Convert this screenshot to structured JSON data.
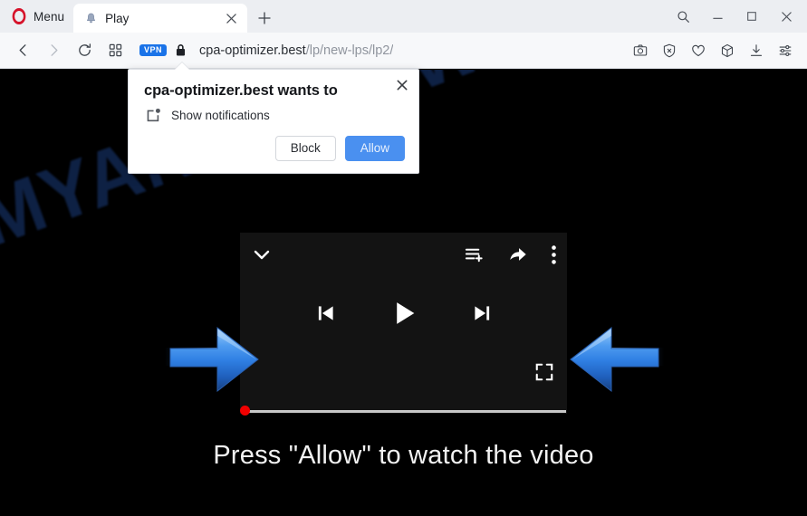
{
  "browser": {
    "name": "Opera",
    "menu_label": "Menu",
    "tab": {
      "title": "Play",
      "favicon": "bell-favicon",
      "close_label": "×"
    },
    "new_tab_label": "+",
    "window_controls": [
      {
        "name": "search-icon",
        "label": "Search"
      },
      {
        "name": "minimize-icon",
        "label": "Minimize"
      },
      {
        "name": "maximize-icon",
        "label": "Maximize"
      },
      {
        "name": "close-icon",
        "label": "Close"
      }
    ],
    "navigation": [
      {
        "name": "back-button",
        "label": "Back",
        "enabled": true
      },
      {
        "name": "forward-button",
        "label": "Forward",
        "enabled": false
      },
      {
        "name": "reload-button",
        "label": "Reload",
        "enabled": true
      },
      {
        "name": "tab-overview-button",
        "label": "Tab overview",
        "enabled": true
      }
    ],
    "address_bar": {
      "vpn_badge": "VPN",
      "lock_icon": "lock-icon",
      "url_domain": "cpa-optimizer.best",
      "url_path": "/lp/new-lps/lp2/",
      "full_url": "cpa-optimizer.best/lp/new-lps/lp2/"
    },
    "toolbar_icons": [
      {
        "name": "snapshot-icon",
        "label": "Snapshot"
      },
      {
        "name": "ad-blocker-icon",
        "label": "Ad blocker"
      },
      {
        "name": "heart-icon",
        "label": "Add to favorites"
      },
      {
        "name": "cube-icon",
        "label": "Extensions"
      },
      {
        "name": "downloads-icon",
        "label": "Downloads"
      },
      {
        "name": "easy-setup-icon",
        "label": "Easy setup"
      }
    ]
  },
  "permission_dialog": {
    "title": "cpa-optimizer.best wants to",
    "permission_icon": "notification-icon",
    "permission_text": "Show notifications",
    "block_label": "Block",
    "allow_label": "Allow",
    "close_label": "×",
    "allow_color": "#4a90f0"
  },
  "page": {
    "watermark": "MYANTISPYWARE.COM",
    "watermark_color": "#10244a",
    "cta_text": "Press \"Allow\" to watch the video",
    "background_color": "#000000",
    "player": {
      "background_color": "#131313",
      "top_controls": [
        {
          "name": "collapse-chevron-icon",
          "label": "Collapse"
        },
        {
          "name": "add-to-queue-icon",
          "label": "Add to queue"
        },
        {
          "name": "share-icon",
          "label": "Share"
        },
        {
          "name": "more-options-icon",
          "label": "More options"
        }
      ],
      "transport_controls": [
        {
          "name": "previous-track-button",
          "label": "Previous"
        },
        {
          "name": "play-button",
          "label": "Play"
        },
        {
          "name": "next-track-button",
          "label": "Next"
        }
      ],
      "fullscreen_label": "Fullscreen",
      "progress_dot_color": "#f10000",
      "progress_track_color": "#c8c8c8",
      "progress_percent": 0
    },
    "arrows": [
      {
        "name": "pointing-arrow-right",
        "direction": "right",
        "color": "#2f86ec"
      },
      {
        "name": "pointing-arrow-left",
        "direction": "left",
        "color": "#2f86ec"
      }
    ]
  }
}
